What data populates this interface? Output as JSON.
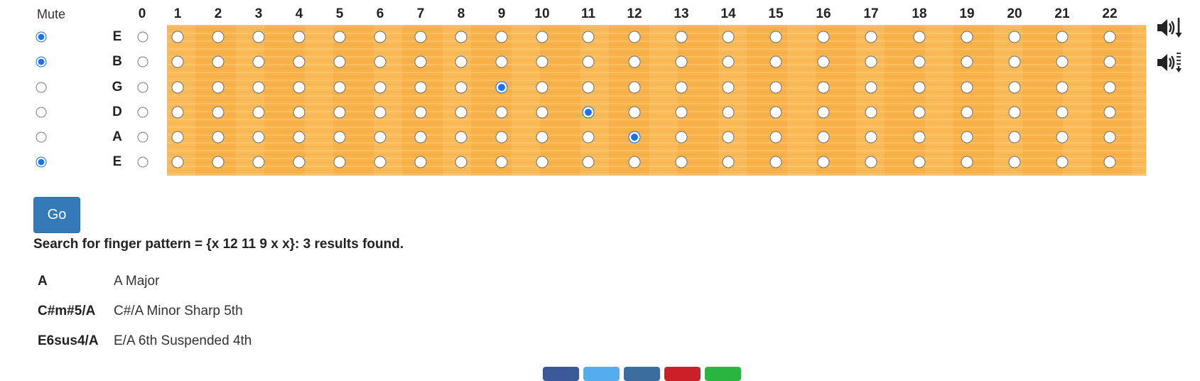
{
  "mute_label": "Mute",
  "frets": [
    "0",
    "1",
    "2",
    "3",
    "4",
    "5",
    "6",
    "7",
    "8",
    "9",
    "10",
    "11",
    "12",
    "13",
    "14",
    "15",
    "16",
    "17",
    "18",
    "19",
    "20",
    "21",
    "22"
  ],
  "strings": [
    {
      "name": "E",
      "muted": true,
      "selected_fret": null
    },
    {
      "name": "B",
      "muted": true,
      "selected_fret": null
    },
    {
      "name": "G",
      "muted": false,
      "selected_fret": 9
    },
    {
      "name": "D",
      "muted": false,
      "selected_fret": 11
    },
    {
      "name": "A",
      "muted": false,
      "selected_fret": 12
    },
    {
      "name": "E",
      "muted": true,
      "selected_fret": null
    }
  ],
  "sound_icons": [
    "sound-strum-down-icon",
    "sound-arpeggio-down-icon"
  ],
  "go_button_label": "Go",
  "search_summary": "Search for finger pattern = {x 12 11 9 x x}: 3 results found.",
  "results": [
    {
      "chord": "A",
      "name": "A Major"
    },
    {
      "chord": "C#m#5/A",
      "name": "C#/A Minor Sharp 5th"
    },
    {
      "chord": "E6sus4/A",
      "name": "E/A 6th Suspended 4th"
    }
  ],
  "share_buttons": [
    {
      "name": "facebook-share-button",
      "color": "#3b5998"
    },
    {
      "name": "twitter-share-button",
      "color": "#55acee"
    },
    {
      "name": "linkedin-share-button",
      "color": "#3b6e9e"
    },
    {
      "name": "pinterest-share-button",
      "color": "#cb2027"
    },
    {
      "name": "whatsapp-share-button",
      "color": "#2ab540"
    }
  ],
  "colors": {
    "fretboard": "#f9b24a",
    "accent": "#337ab7",
    "selected_radio": "#1a73e8"
  }
}
